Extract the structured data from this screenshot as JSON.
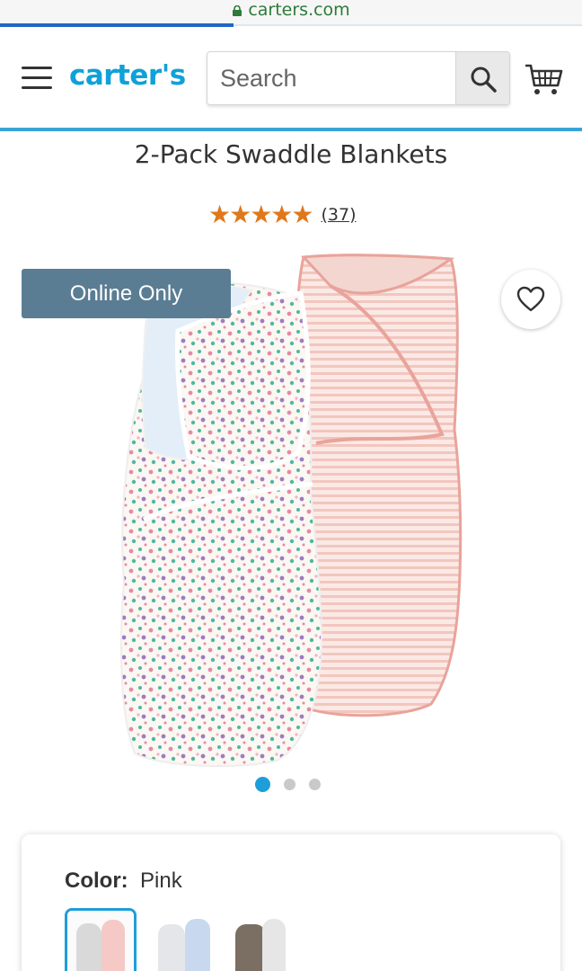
{
  "browser": {
    "url": "carters.com"
  },
  "header": {
    "logo": "carter's",
    "search_placeholder": "Search"
  },
  "product": {
    "title": "2-Pack Swaddle Blankets",
    "rating": 4.5,
    "stars": "★★★★★",
    "review_count": "(37)",
    "badge": "Online Only",
    "carousel": {
      "total": 3,
      "active": 1
    }
  },
  "color": {
    "label": "Color:",
    "selected": "Pink",
    "swatches": [
      "Pink",
      "Blue",
      "Gray"
    ]
  },
  "colors": {
    "brand": "#0fa1d8",
    "star": "#e0781b",
    "badge": "#5b7d93",
    "accent": "#1e9ed8"
  },
  "icons": {
    "menu": "hamburger-icon",
    "search": "search-icon",
    "cart": "cart-icon",
    "favorite": "heart-icon",
    "secure": "lock-icon"
  }
}
